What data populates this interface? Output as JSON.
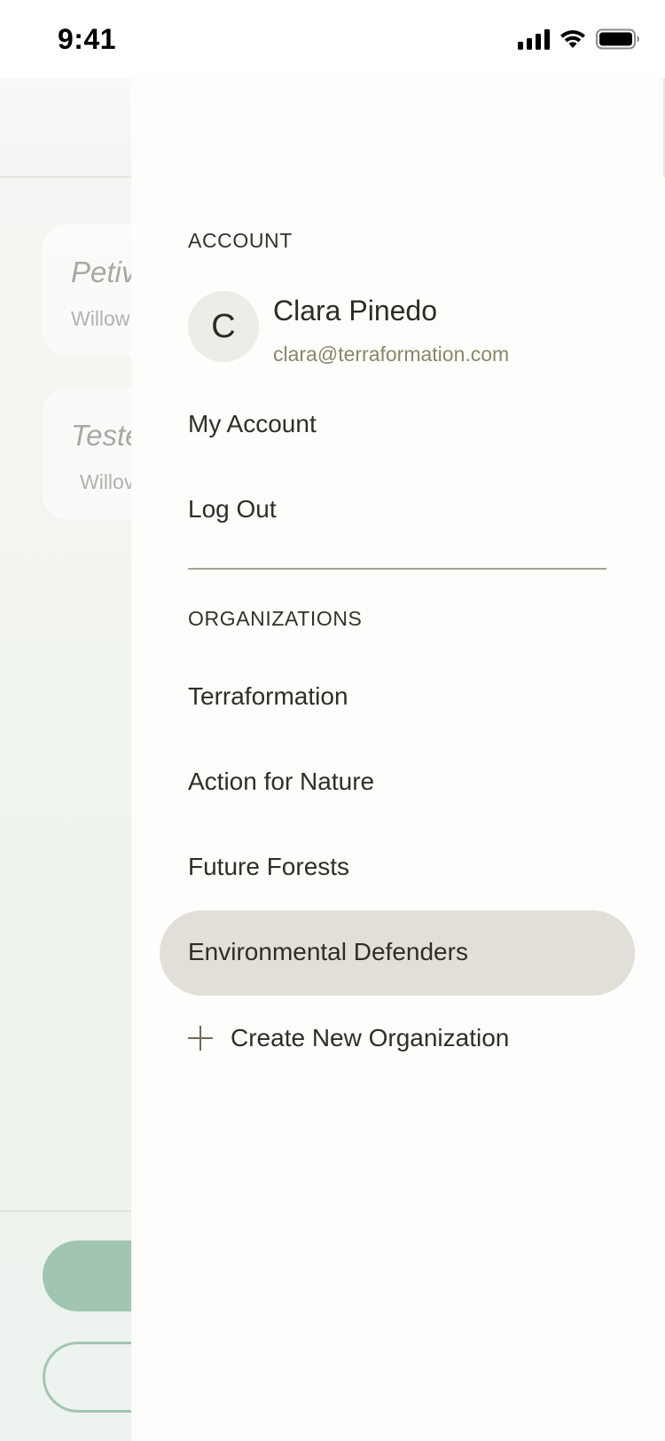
{
  "status_bar": {
    "time": "9:41"
  },
  "background_app": {
    "cards": [
      {
        "title": "Petiv",
        "subtitle": "Willow"
      },
      {
        "title": "Teste",
        "subtitle": "Willov"
      }
    ]
  },
  "drawer": {
    "account_section": {
      "heading": "ACCOUNT",
      "avatar_initial": "C",
      "user_name": "Clara Pinedo",
      "user_email": "clara@terraformation.com",
      "items": [
        "My Account",
        "Log Out"
      ]
    },
    "organizations_section": {
      "heading": "ORGANIZATIONS",
      "items": [
        {
          "label": "Terraformation",
          "selected": false
        },
        {
          "label": "Action for Nature",
          "selected": false
        },
        {
          "label": "Future Forests",
          "selected": false
        },
        {
          "label": "Environmental Defenders",
          "selected": true
        }
      ],
      "create_label": "Create New Organization"
    }
  },
  "colors": {
    "selected_org_bg": "#e1dfd7",
    "email_text": "#8a8668",
    "divider": "#a5a78c",
    "primary_green": "#a2c5b1"
  }
}
